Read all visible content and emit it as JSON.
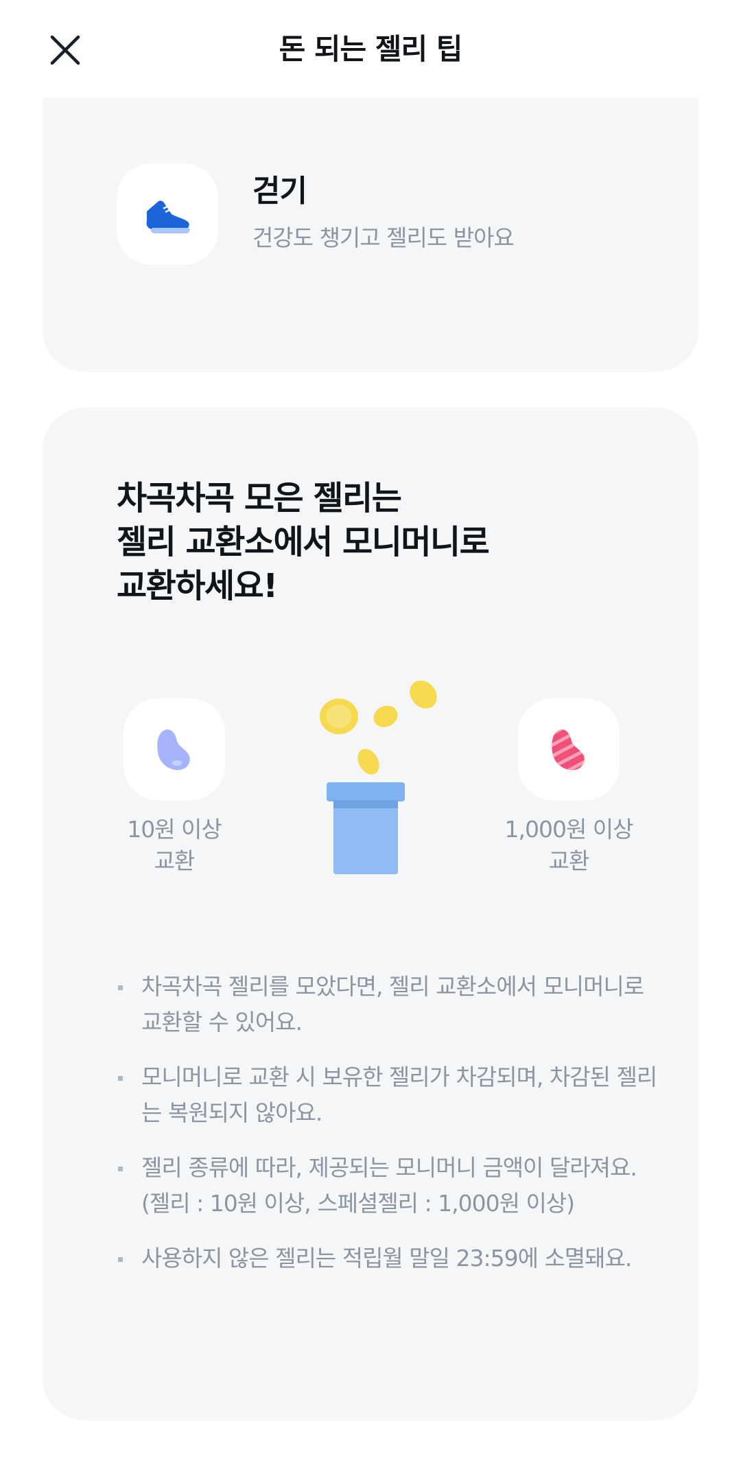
{
  "header": {
    "title": "돈 되는 젤리 팁"
  },
  "walk": {
    "title": "걷기",
    "subtitle": "건강도 챙기고 젤리도 받아요",
    "icon": "sneaker-icon"
  },
  "exchange": {
    "headline": [
      "차곡차곡 모은 젤리는",
      "젤리 교환소에서 모니머니로",
      "교환하세요!"
    ],
    "jelly_basic": {
      "line1": "10원 이상",
      "line2": "교환",
      "icon": "blue-jelly-bean-icon"
    },
    "jelly_special": {
      "line1": "1,000원 이상",
      "line2": "교환",
      "icon": "striped-pink-jelly-bean-icon"
    },
    "notes": [
      "차곡차곡 젤리를 모았다면, 젤리 교환소에서 모니머니로 교환할 수 있어요.",
      "모니머니로 교환 시 보유한 젤리가 차감되며, 차감된 젤리는 복원되지 않아요.",
      "젤리 종류에 따라, 제공되는 모니머니 금액이 달라져요. (젤리 : 10원 이상, 스페셜젤리 : 1,000원 이상)",
      "사용하지 않은 젤리는 적립월 말일 23:59에 소멸돼요."
    ]
  },
  "colors": {
    "card_bg": "#f5f6f8",
    "muted_text": "#8b95a1",
    "primary": "#3182f6"
  }
}
